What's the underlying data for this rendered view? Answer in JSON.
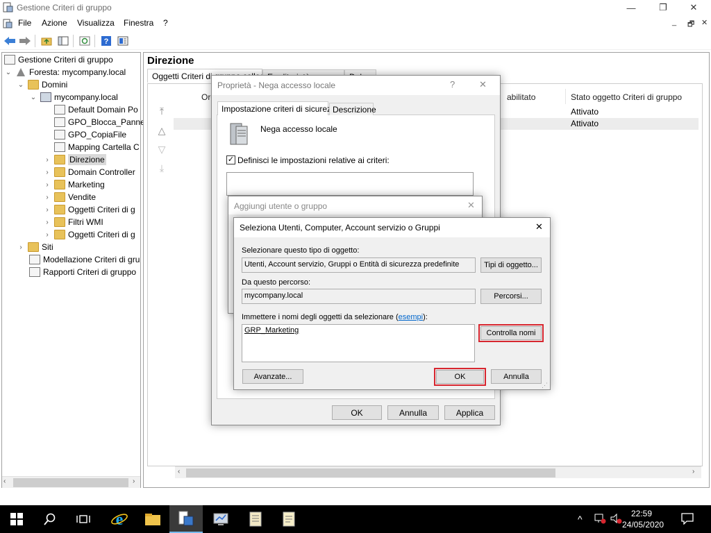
{
  "window": {
    "title": "Gestione Criteri di gruppo",
    "controls": {
      "minimize": "—",
      "maximize": "❐",
      "close": "✕"
    },
    "inner_controls": {
      "minimize": "_",
      "restore": "🗗",
      "close": "✕"
    }
  },
  "menu": [
    "File",
    "Azione",
    "Visualizza",
    "Finestra",
    "?"
  ],
  "tree": {
    "root": "Gestione Criteri di gruppo",
    "forest": "Foresta: mycompany.local",
    "domains": "Domini",
    "domain": "mycompany.local",
    "items": [
      "Default Domain Po",
      "GPO_Blocca_Panne",
      "GPO_CopiaFile",
      "Mapping Cartella C",
      "Direzione",
      "Domain Controller",
      "Marketing",
      "Vendite",
      "Oggetti Criteri di g",
      "Filtri WMI",
      "Oggetti Criteri di g"
    ],
    "sites": "Siti",
    "modeling": "Modellazione Criteri di gru",
    "reports": "Rapporti Criteri di gruppo"
  },
  "main": {
    "title": "Direzione",
    "tabs": [
      "Oggetti Criteri di gruppo collegati",
      "Ereditarietà",
      "Delega"
    ],
    "columns": [
      "Ord",
      "abilitato",
      "Stato oggetto Criteri di gruppo"
    ],
    "rows": [
      {
        "status": "Attivato"
      },
      {
        "status": "Attivato"
      }
    ]
  },
  "dialog_props": {
    "title": "Proprietà - Nega accesso locale",
    "help": "?",
    "close": "✕",
    "tabs": [
      "Impostazione criteri di sicurezza",
      "Descrizione"
    ],
    "policy_name": "Nega accesso locale",
    "checkbox_label": "Definisci le impostazioni relative ai criteri:",
    "checkbox_checked": true,
    "buttons": {
      "ok": "OK",
      "cancel": "Annulla",
      "apply": "Applica"
    }
  },
  "dialog_add": {
    "title": "Aggiungi utente o gruppo",
    "close": "✕"
  },
  "dialog_select": {
    "title": "Seleziona Utenti, Computer, Account servizio o Gruppi",
    "close": "✕",
    "object_type_label": "Selezionare questo tipo di oggetto:",
    "object_type_value": "Utenti, Account servizio, Gruppi o Entità di sicurezza predefinite",
    "object_type_button": "Tipi di oggetto...",
    "location_label": "Da questo percorso:",
    "location_value": "mycompany.local",
    "location_button": "Percorsi...",
    "names_label_prefix": "Immettere i nomi degli oggetti da selezionare (",
    "names_label_link": "esempi",
    "names_label_suffix": "):",
    "names_value": "GRP_Marketing",
    "check_names_button": "Controlla nomi",
    "advanced_button": "Avanzate...",
    "ok_button": "OK",
    "cancel_button": "Annulla"
  },
  "taskbar": {
    "time": "22:59",
    "date": "24/05/2020"
  },
  "colors": {
    "accent_red": "#d7262f",
    "link": "#0066cc",
    "taskbar": "#000000"
  }
}
